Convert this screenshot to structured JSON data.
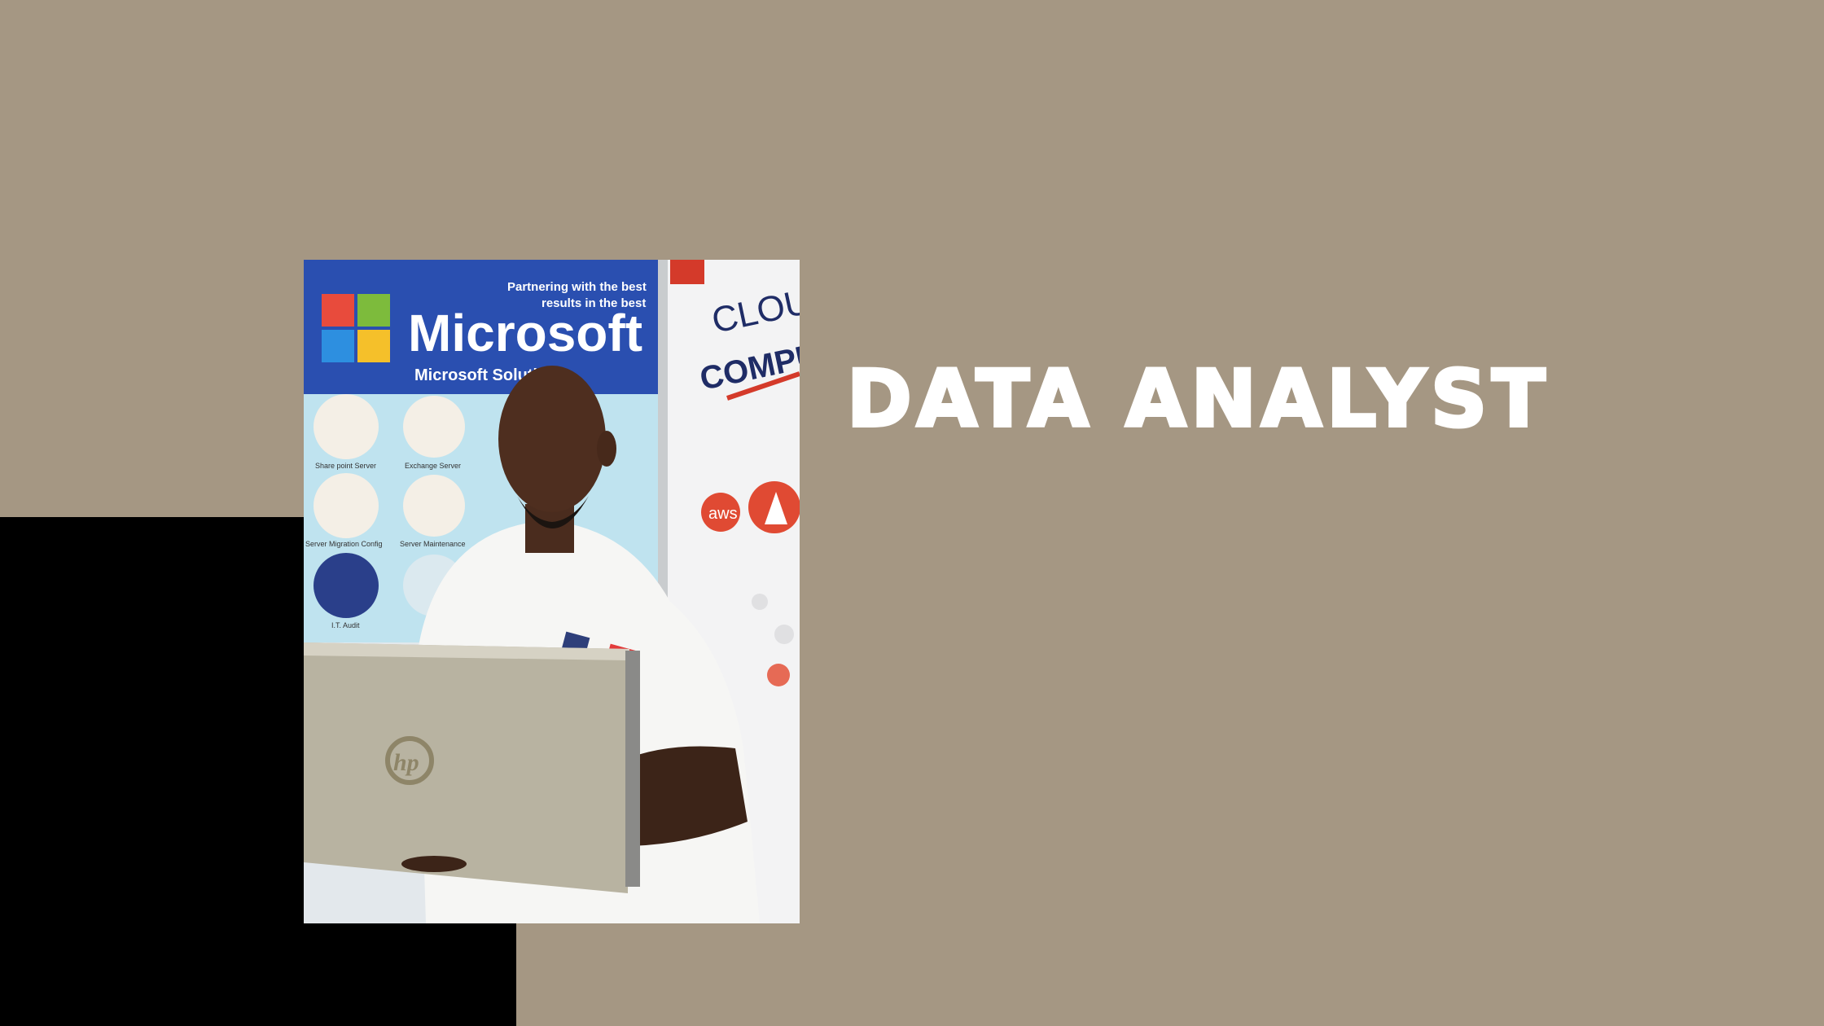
{
  "slide": {
    "title": "DATA ANALYST",
    "background_color": "#a59783",
    "accent_color": "#000000",
    "title_color": "#ffffff"
  },
  "photo": {
    "banner_brand": "Microsoft",
    "banner_sub": "Microsoft Solutions",
    "banner_tagline_1": "Partnering with the best",
    "banner_tagline_2": "results in the best",
    "service_1": "Share point Server",
    "service_2": "Exchange Server",
    "service_3": "Server Migration Config",
    "service_4": "Server Maintenance",
    "service_5": "I.T. Audit",
    "poster_text_1": "CLOU",
    "poster_text_2": "COMPUT",
    "aws_label": "aws",
    "laptop_logo": "hp"
  }
}
